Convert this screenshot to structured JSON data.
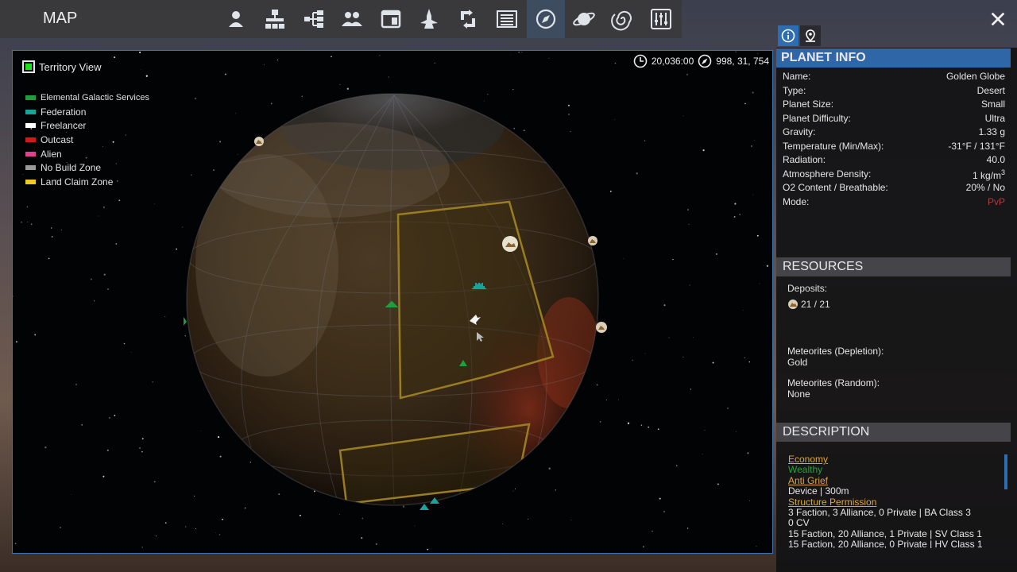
{
  "app": {
    "title": "MAP"
  },
  "nav": {
    "icons": [
      "player-icon",
      "structures-icon",
      "tech-tree-icon",
      "faction-icon",
      "registry-icon",
      "ship-icon",
      "trade-icon",
      "statistics-icon",
      "map-icon",
      "planet-icon",
      "galaxy-icon",
      "settings-sliders-icon"
    ],
    "active": "map-icon"
  },
  "map": {
    "territory_view_label": "Territory View",
    "time_value": "20,036:00",
    "coords_value": "998, 31, 754",
    "legend": [
      {
        "label": "Elemental Galactic Services",
        "color": "#1e9e3e"
      },
      {
        "label": "Federation",
        "color": "#1aa39a"
      },
      {
        "label": "Freelancer",
        "color": "#ffffff"
      },
      {
        "label": "Outcast",
        "color": "#d01919"
      },
      {
        "label": "Alien",
        "color": "#e0418c"
      },
      {
        "label": "No Build Zone",
        "color": "#9a9a9a"
      },
      {
        "label": "Land Claim Zone",
        "color": "#f2c91c"
      }
    ]
  },
  "planet_info": {
    "header": "PLANET INFO",
    "rows": [
      {
        "label": "Name:",
        "value": "Golden Globe"
      },
      {
        "label": "Type:",
        "value": "Desert"
      },
      {
        "label": "Planet Size:",
        "value": "Small"
      },
      {
        "label": "Planet Difficulty:",
        "value": "Ultra"
      },
      {
        "label": "Gravity:",
        "value": "1.33 g"
      },
      {
        "label": "Temperature (Min/Max):",
        "value": "-31°F / 131°F"
      },
      {
        "label": "Radiation:",
        "value": "40.0"
      },
      {
        "label": "Atmosphere Density:",
        "value": "1 kg/m",
        "sup": "3"
      },
      {
        "label": "O2 Content / Breathable:",
        "value": "20% / No"
      },
      {
        "label": "Mode:",
        "value": "PvP"
      }
    ]
  },
  "resources": {
    "header": "RESOURCES",
    "deposits_label": "Deposits:",
    "deposits_value": "21 / 21",
    "meteorites_depletion_label": "Meteorites (Depletion):",
    "meteorites_depletion_value": "Gold",
    "meteorites_random_label": "Meteorites (Random):",
    "meteorites_random_value": "None"
  },
  "description": {
    "header": "DESCRIPTION",
    "economy_label": "Economy",
    "economy_value": "Wealthy",
    "antigrief_label": "Anti Grief",
    "antigrief_value": "Device | 300m",
    "structure_label": "Structure Permission",
    "lines": [
      "3 Faction, 3 Alliance, 0 Private | BA Class 3",
      "0 CV",
      "15 Faction, 20 Alliance, 1 Private | SV Class 1",
      "15 Faction, 20 Alliance, 0 Private | HV Class 1"
    ]
  },
  "colors": {
    "accent_blue": "#2e66a8",
    "link_orange": "#e0a43c",
    "wealthy_green": "#28a03a",
    "pvp_red": "#b03c3c"
  }
}
